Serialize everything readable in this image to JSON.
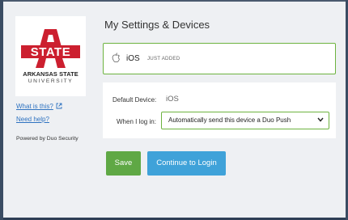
{
  "sidebar": {
    "logo": {
      "monogram": "STATE",
      "line1": "ARKANSAS STATE",
      "line2": "UNIVERSITY"
    },
    "what_is_this": "What is this?",
    "need_help": "Need help?",
    "powered_by": "Powered by Duo Security"
  },
  "main": {
    "title": "My Settings & Devices",
    "device": {
      "name": "iOS",
      "badge": "JUST ADDED"
    },
    "settings": {
      "default_device_label": "Default Device:",
      "default_device_value": "iOS",
      "when_login_label": "When I log in:",
      "when_login_value": "Automatically send this device a Duo Push"
    },
    "buttons": {
      "save": "Save",
      "continue": "Continue to Login"
    }
  },
  "colors": {
    "accent_green": "#6db33f",
    "save_button": "#5fa845",
    "continue_button": "#3fa2d9",
    "link": "#2e72c0",
    "brand_red": "#cc1f2f"
  },
  "icons": {
    "device": "apple-icon",
    "external": "external-link-icon",
    "dropdown": "chevron-down-icon"
  }
}
